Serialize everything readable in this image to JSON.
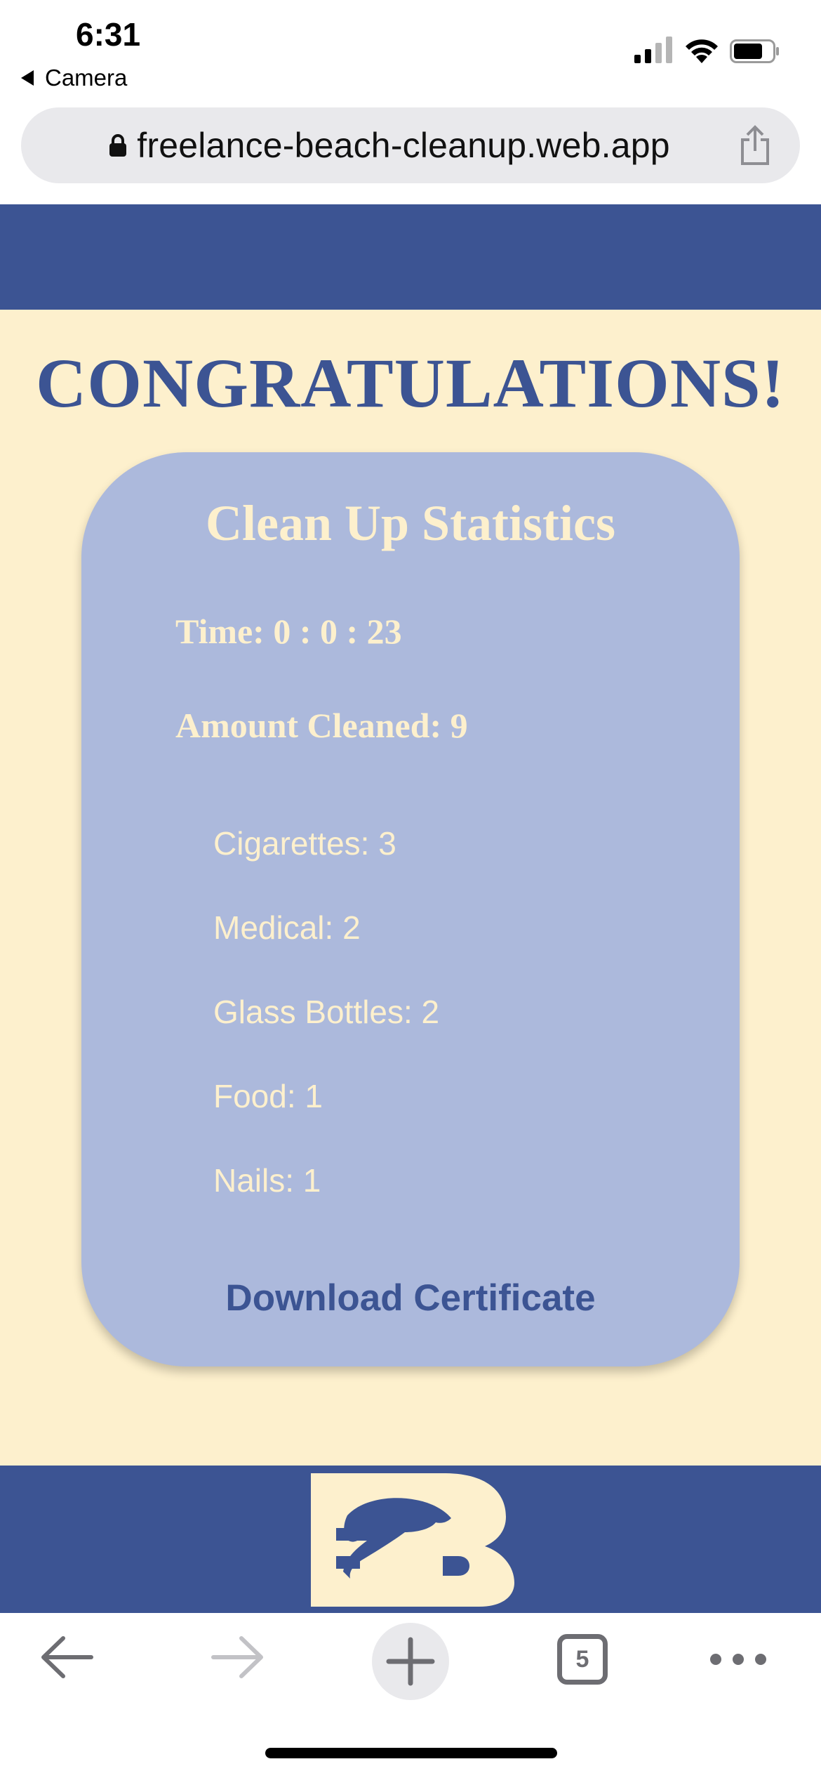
{
  "status_bar": {
    "time": "6:31",
    "back_app": "Camera"
  },
  "browser": {
    "url": "freelance-beach-cleanup.web.app",
    "tab_count": "5"
  },
  "page": {
    "heading": "CONGRATULATIONS!",
    "stats": {
      "title": "Clean Up Statistics",
      "time_label": "Time: 0 : 0 : 23",
      "amount_label": "Amount Cleaned: 9",
      "items": [
        "Cigarettes: 3",
        "Medical: 2",
        "Glass Bottles: 2",
        "Food: 1",
        "Nails: 1"
      ]
    },
    "download_label": "Download Certificate"
  },
  "colors": {
    "brand_blue": "#3c5493",
    "cream": "#fdf0cd",
    "card_blue": "#acb9dc"
  },
  "icons": [
    "lock-icon",
    "share-icon",
    "back-arrow-icon",
    "forward-arrow-icon",
    "plus-icon",
    "tabs-icon",
    "more-icon",
    "signal-icon",
    "wifi-icon",
    "battery-icon",
    "site-logo"
  ]
}
